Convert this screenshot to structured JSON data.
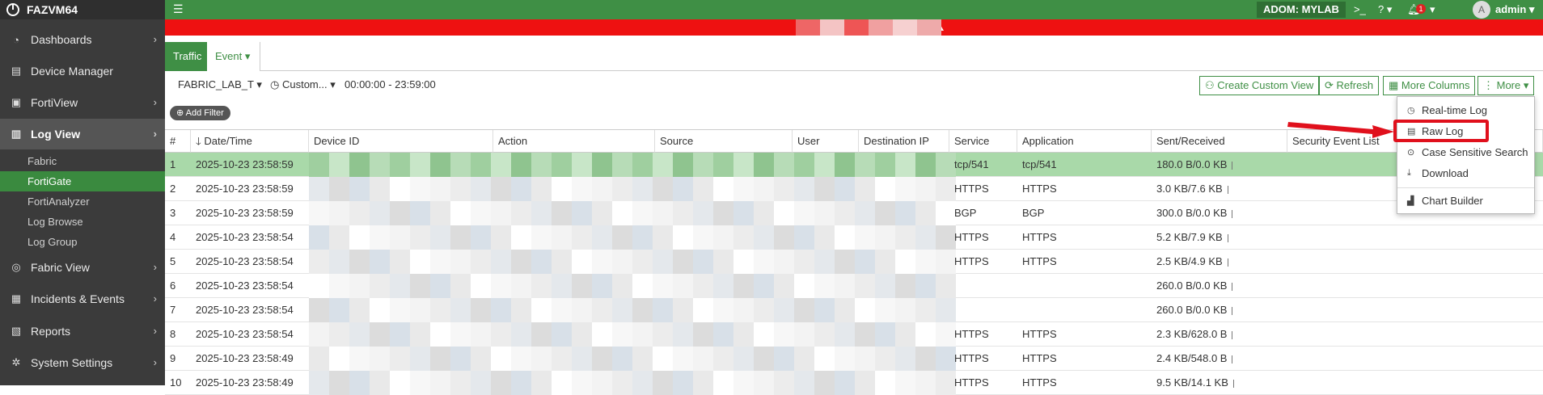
{
  "sidebar": {
    "brand": "FAZVM64",
    "items": [
      {
        "label": "Dashboards",
        "icon": "dashboard-icon"
      },
      {
        "label": "Device Manager",
        "icon": "device-manager-icon"
      },
      {
        "label": "FortiView",
        "icon": "fortiview-icon"
      },
      {
        "label": "Log View",
        "icon": "log-view-icon"
      },
      {
        "label": "Fabric View",
        "icon": "fabric-view-icon"
      },
      {
        "label": "Incidents & Events",
        "icon": "incidents-icon"
      },
      {
        "label": "Reports",
        "icon": "reports-icon"
      },
      {
        "label": "System Settings",
        "icon": "settings-icon"
      }
    ],
    "subitems": [
      "Fabric",
      "FortiGate",
      "FortiAnalyzer",
      "Log Browse",
      "Log Group"
    ]
  },
  "topbar": {
    "adom": "ADOM: MYLAB",
    "notification_count": "1",
    "avatar_letter": "A",
    "user": "admin"
  },
  "tabs": {
    "traffic": "Traffic",
    "event": "Event"
  },
  "toolbar": {
    "device_select": "FABRIC_LAB_T",
    "time_select": "Custom...",
    "time_range": "00:00:00 - 23:59:00",
    "create_custom_view": "Create Custom View",
    "refresh": "Refresh",
    "more_columns": "More Columns",
    "more": "More",
    "add_filter": "Add Filter"
  },
  "table": {
    "headers": [
      "#",
      "Date/Time",
      "Device ID",
      "Action",
      "Source",
      "User",
      "Destination IP",
      "Service",
      "Application",
      "Sent/Received",
      "Security Event List"
    ],
    "rows": [
      {
        "n": "1",
        "dt": "2025-10-23 23:58:59",
        "service": "tcp/541",
        "app": "tcp/541",
        "sent": "180.0 B/0.0 KB"
      },
      {
        "n": "2",
        "dt": "2025-10-23 23:58:59",
        "service": "HTTPS",
        "app": "HTTPS",
        "sent": "3.0 KB/7.6 KB"
      },
      {
        "n": "3",
        "dt": "2025-10-23 23:58:59",
        "service": "BGP",
        "app": "BGP",
        "sent": "300.0 B/0.0 KB"
      },
      {
        "n": "4",
        "dt": "2025-10-23 23:58:54",
        "service": "HTTPS",
        "app": "HTTPS",
        "sent": "5.2 KB/7.9 KB"
      },
      {
        "n": "5",
        "dt": "2025-10-23 23:58:54",
        "service": "HTTPS",
        "app": "HTTPS",
        "sent": "2.5 KB/4.9 KB"
      },
      {
        "n": "6",
        "dt": "2025-10-23 23:58:54",
        "service": "",
        "app": "",
        "sent": "260.0 B/0.0 KB"
      },
      {
        "n": "7",
        "dt": "2025-10-23 23:58:54",
        "service": "",
        "app": "",
        "sent": "260.0 B/0.0 KB"
      },
      {
        "n": "8",
        "dt": "2025-10-23 23:58:54",
        "service": "HTTPS",
        "app": "HTTPS",
        "sent": "2.3 KB/628.0 B"
      },
      {
        "n": "9",
        "dt": "2025-10-23 23:58:49",
        "service": "HTTPS",
        "app": "HTTPS",
        "sent": "2.4 KB/548.0 B"
      },
      {
        "n": "10",
        "dt": "2025-10-23 23:58:49",
        "service": "HTTPS",
        "app": "HTTPS",
        "sent": "9.5 KB/14.1 KB"
      }
    ]
  },
  "more_menu": {
    "items": [
      {
        "label": "Real-time Log",
        "icon": "clock-icon"
      },
      {
        "label": "Raw Log",
        "icon": "raw-log-icon"
      },
      {
        "label": "Case Sensitive Search",
        "icon": "search-case-icon"
      },
      {
        "label": "Download",
        "icon": "download-icon"
      },
      {
        "label": "Chart Builder",
        "icon": "chart-builder-icon"
      }
    ]
  },
  "colors": {
    "brand_green": "#3f8f45",
    "alert_red": "#ee1111",
    "sidebar_bg": "#3b3b3b",
    "selected_row": "#a9d9a9",
    "highlight_red": "#e0101c"
  }
}
